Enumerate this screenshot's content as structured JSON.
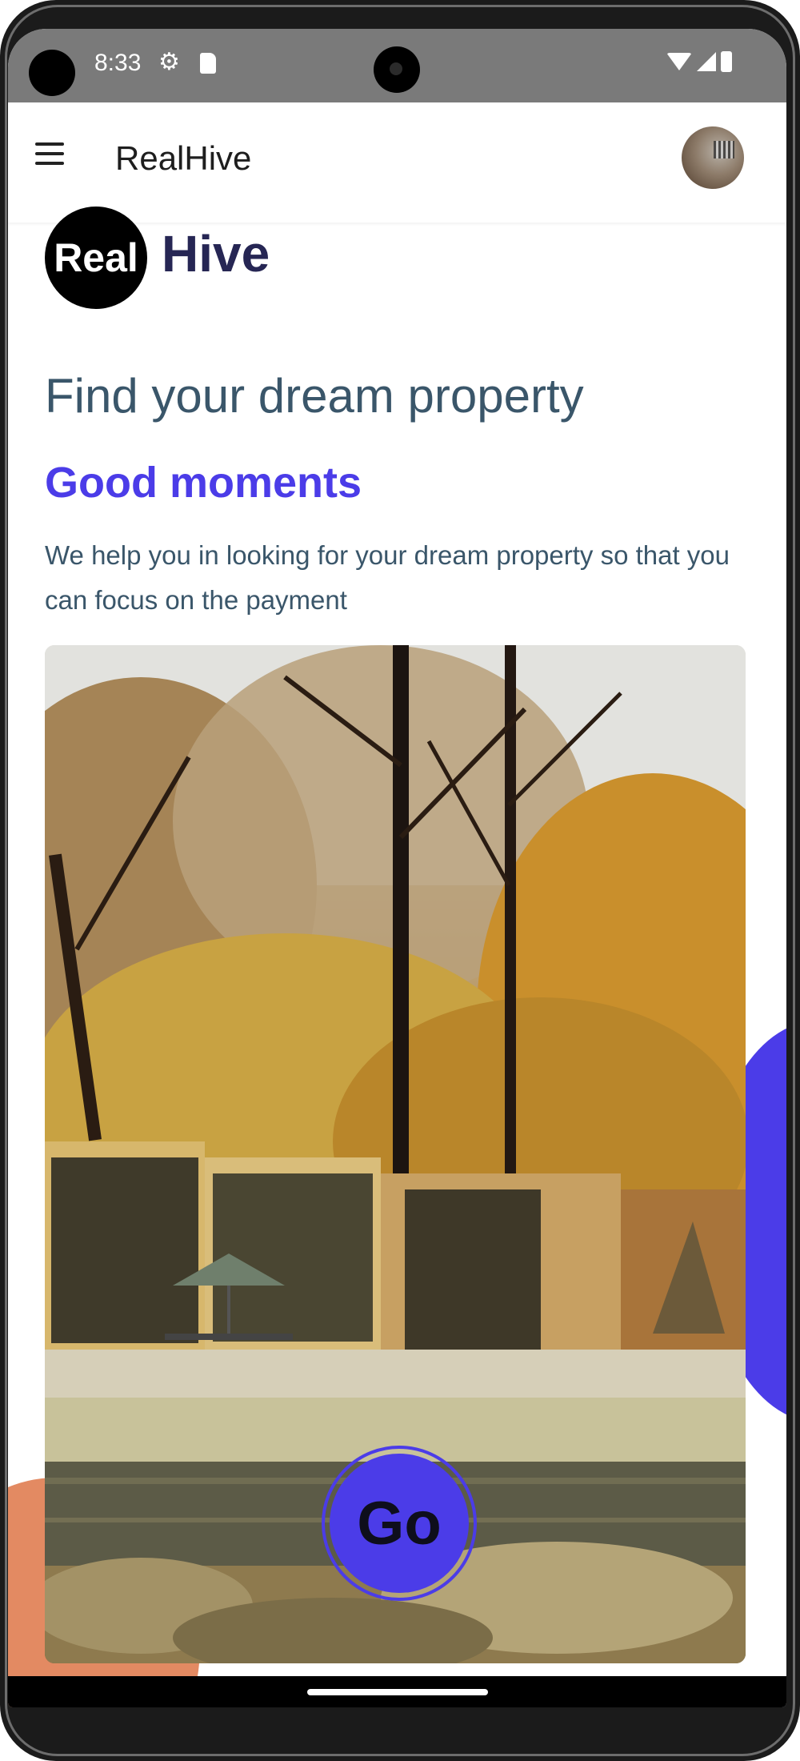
{
  "status_bar": {
    "time": "8:33",
    "icons": [
      "gear-icon",
      "sd-card-icon",
      "wifi-icon",
      "signal-icon",
      "battery-icon"
    ]
  },
  "app_bar": {
    "title": "RealHive",
    "menu_icon": "menu-icon",
    "avatar": "user-avatar"
  },
  "logo": {
    "mark_text": "Real",
    "word_text": "Hive"
  },
  "hero": {
    "headline": "Find your dream property",
    "subheadline": "Good moments",
    "description": "We help you in looking for your dream property so that you can focus on the payment"
  },
  "cta": {
    "go_label": "Go"
  },
  "colors": {
    "accent": "#4b3ce8",
    "headline": "#3a566a",
    "logo_word": "#262654",
    "orange_blob": "#e38a62"
  }
}
